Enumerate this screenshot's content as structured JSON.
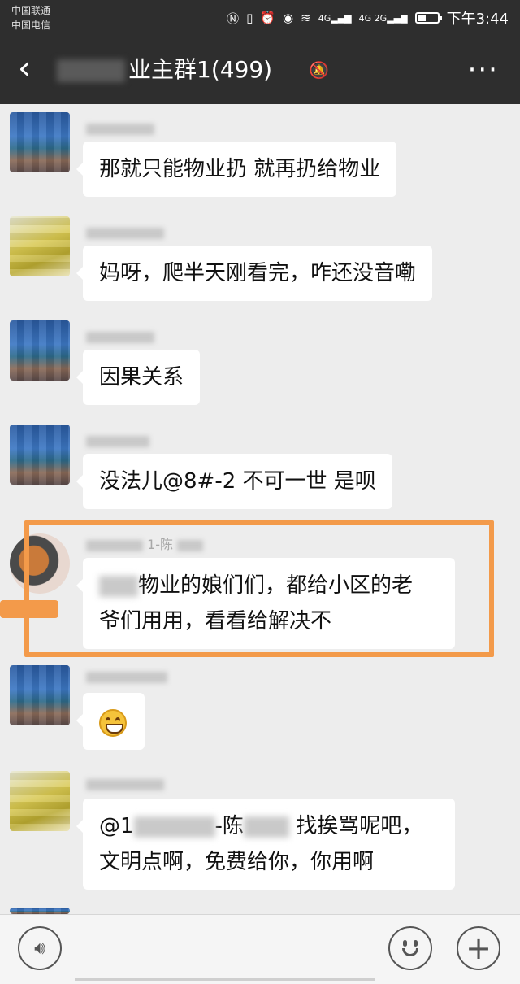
{
  "status_bar": {
    "carrier_1": "中国联通",
    "carrier_2": "中国电信",
    "icons": [
      "nfc-icon",
      "vibrate-icon",
      "alarm-icon",
      "eye-icon",
      "wifi-icon",
      "signal-4g-icon",
      "signal-4g-26-icon",
      "battery-icon"
    ],
    "signal_label_1": "4G",
    "signal_label_2": "4G 2G",
    "time": "下午3:44"
  },
  "header": {
    "title": "业主群1(499)",
    "back_icon": "back-chevron-icon",
    "mute_icon": "mute-bell-icon",
    "more_icon": "more-dots-icon"
  },
  "messages": [
    {
      "avatar": "sky-avatar",
      "nickname": "",
      "text": "那就只能物业扔 就再扔给物业"
    },
    {
      "avatar": "yellow-avatar",
      "nickname": "",
      "text": "妈呀，爬半天刚看完，咋还没音嘞"
    },
    {
      "avatar": "sky-avatar",
      "nickname": "",
      "text": "因果关系"
    },
    {
      "avatar": "sky-avatar",
      "nickname": "",
      "text": "没法儿@8#-2 不可一世  是呗"
    },
    {
      "avatar": "cat-avatar",
      "nickname": "1-陈",
      "line1": "物业的娘们们，都给小区的老",
      "line2": "爷们用用，看看给解决不"
    },
    {
      "avatar": "sky-avatar",
      "nickname": "",
      "text": "grinning-emoji"
    },
    {
      "avatar": "yellow-avatar",
      "nickname": "",
      "line1_prefix": "@1",
      "line1_mid": "-陈",
      "line1_suffix": "找挨骂呢吧，",
      "line2": "文明点啊，免费给你，你用啊"
    }
  ],
  "annotation": {
    "color": "#f39a4a"
  },
  "input_bar": {
    "voice_icon": "voice-icon",
    "emoji_icon": "emoji-icon",
    "plus_icon": "plus-icon"
  },
  "colors": {
    "nav_bg": "#2e2e2e",
    "chat_bg": "#ededed",
    "bubble": "#ffffff"
  }
}
